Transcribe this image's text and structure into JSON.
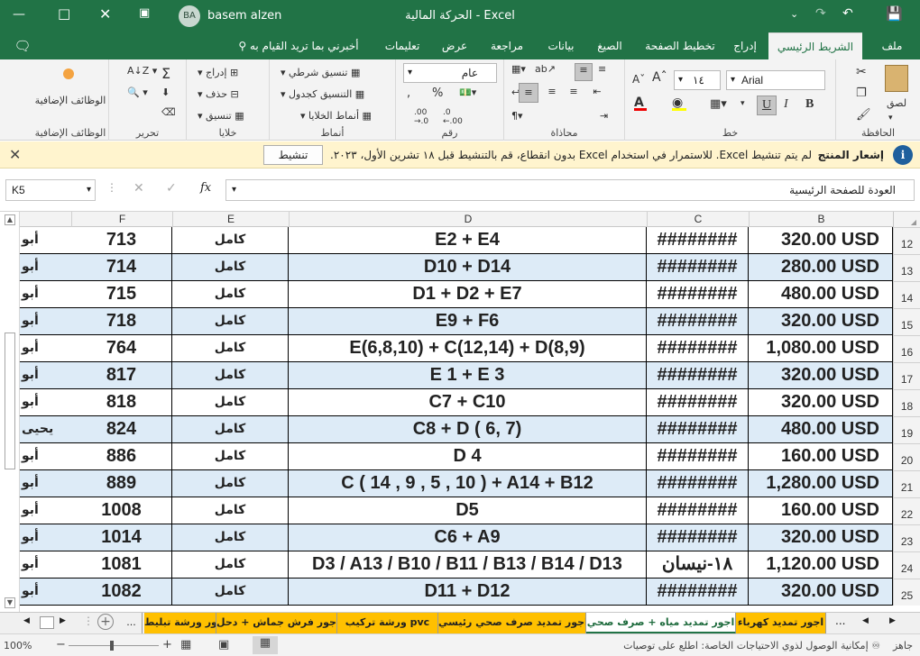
{
  "app": {
    "user_initials": "BA",
    "user_name": "basem alzen",
    "document_title": "الحركة المالية  -  Excel"
  },
  "ribbon_tabs": [
    {
      "label": "ملف"
    },
    {
      "label": "الشريط الرئيسي"
    },
    {
      "label": "إدراج"
    },
    {
      "label": "تخطيط الصفحة"
    },
    {
      "label": "الصيغ"
    },
    {
      "label": "بيانات"
    },
    {
      "label": "مراجعة"
    },
    {
      "label": "عرض"
    },
    {
      "label": "تعليمات"
    },
    {
      "label": "أخبرني بما تريد القيام به"
    }
  ],
  "ribbon": {
    "clipboard": {
      "group": "الحافظة",
      "paste": "لصق"
    },
    "font": {
      "group": "خط",
      "name": "Arial",
      "size": "١٤",
      "bold": "B",
      "italic": "I",
      "underline": "U"
    },
    "alignment": {
      "group": "محاذاة"
    },
    "number": {
      "group": "رقم",
      "format": "عام"
    },
    "styles": {
      "group": "أنماط",
      "conditional": "تنسيق شرطي",
      "table": "التنسيق كجدول",
      "cell_styles": "أنماط الخلايا"
    },
    "cells": {
      "group": "خلايا",
      "insert": "إدراج",
      "delete": "حذف",
      "format": "تنسيق"
    },
    "editing": {
      "group": "تحرير"
    },
    "addins": {
      "group": "الوظائف الإضافية",
      "label": "الوظائف الإضافية"
    }
  },
  "notification": {
    "title": "إشعار المنتج",
    "message": "لم يتم تنشيط Excel. للاستمرار في استخدام Excel بدون انقطاع، قم بالتنشيط قبل ١٨ تشرين الأول، ٢٠٢٣.",
    "button": "تنشيط"
  },
  "formula_bar": {
    "name_box": "K5",
    "formula": "العودة للصفحة الرئيسية",
    "fx": "fx"
  },
  "columns": [
    "B",
    "C",
    "D",
    "E",
    "F"
  ],
  "rows": [
    {
      "num": "12",
      "b": "320.00 USD",
      "c": "########",
      "d": "E2 + E4",
      "e": "كامل",
      "f": "713",
      "g": "أبو"
    },
    {
      "num": "13",
      "b": "280.00 USD",
      "c": "########",
      "d": "D10 + D14",
      "e": "كامل",
      "f": "714",
      "g": "أبو"
    },
    {
      "num": "14",
      "b": "480.00 USD",
      "c": "########",
      "d": "D1 + D2 + E7",
      "e": "كامل",
      "f": "715",
      "g": "أبو"
    },
    {
      "num": "15",
      "b": "320.00 USD",
      "c": "########",
      "d": "E9 + F6",
      "e": "كامل",
      "f": "718",
      "g": "أبو"
    },
    {
      "num": "16",
      "b": "1,080.00 USD",
      "c": "########",
      "d": "E(6,8,10) + C(12,14) + D(8,9)",
      "e": "كامل",
      "f": "764",
      "g": "أبو"
    },
    {
      "num": "17",
      "b": "320.00 USD",
      "c": "########",
      "d": "E 1 + E 3",
      "e": "كامل",
      "f": "817",
      "g": "أبو"
    },
    {
      "num": "18",
      "b": "320.00 USD",
      "c": "########",
      "d": "C7 + C10",
      "e": "كامل",
      "f": "818",
      "g": "أبو"
    },
    {
      "num": "19",
      "b": "480.00 USD",
      "c": "########",
      "d": "C8 + D ( 6, 7)",
      "e": "كامل",
      "f": "824",
      "g": "يحيى"
    },
    {
      "num": "20",
      "b": "160.00 USD",
      "c": "########",
      "d": "D 4",
      "e": "كامل",
      "f": "886",
      "g": "أبو"
    },
    {
      "num": "21",
      "b": "1,280.00 USD",
      "c": "########",
      "d": "C ( 14 , 9 , 5 , 10 ) + A14 + B12",
      "e": "كامل",
      "f": "889",
      "g": "أبو"
    },
    {
      "num": "22",
      "b": "160.00 USD",
      "c": "########",
      "d": "D5",
      "e": "كامل",
      "f": "1008",
      "g": "أبو"
    },
    {
      "num": "23",
      "b": "320.00 USD",
      "c": "########",
      "d": "C6 + A9",
      "e": "كامل",
      "f": "1014",
      "g": "أبو"
    },
    {
      "num": "24",
      "b": "1,120.00 USD",
      "c": "١٨-نيسان",
      "d": "D3 / A13 / B10 / B11 / B13 / B14 / D13",
      "e": "كامل",
      "f": "1081",
      "g": "أبو"
    },
    {
      "num": "25",
      "b": "320.00 USD",
      "c": "########",
      "d": "D11 + D12",
      "e": "كامل",
      "f": "1082",
      "g": "أبو"
    }
  ],
  "sheet_tabs": [
    {
      "label": "اجور تمديد كهرباء"
    },
    {
      "label": "اجور تمديد مياه + صرف صحي"
    },
    {
      "label": "اجور تمديد صرف صحي رئيسي"
    },
    {
      "label": "ورشة تركيب pvc"
    },
    {
      "label": "اجور فرش جماش + دحل"
    },
    {
      "label": "اجور ورشة تبليط"
    },
    {
      "label": "..."
    }
  ],
  "status": {
    "ready": "جاهز",
    "accessibility": "إمكانية الوصول لذوي الاحتياجات الخاصة: اطلع على توصيات",
    "zoom": "100%"
  },
  "colors": {
    "accent": "#217346",
    "row_blue": "#ddebf7",
    "tab_yellow": "#ffc000"
  }
}
